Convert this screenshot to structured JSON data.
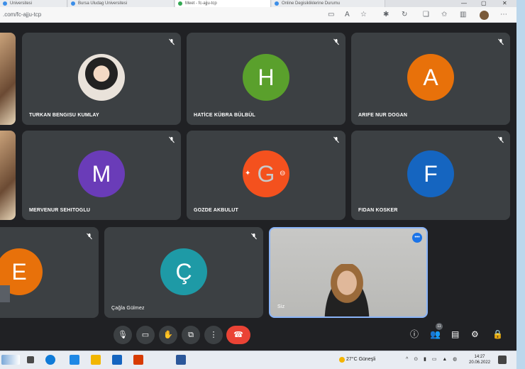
{
  "browser": {
    "tabs": [
      {
        "label": "Universitesi"
      },
      {
        "label": "Bursa Uludag Universitesi"
      },
      {
        "label": "Meet - fc-ajju-tcp",
        "active": true
      },
      {
        "label": "Online Degisikliklerine Durumu"
      }
    ],
    "url": ".com/fc-ajju-tcp",
    "window_controls": [
      "—",
      "▢",
      "✕"
    ]
  },
  "participants": [
    {
      "name": "TURKAN BENGISU KUMLAY",
      "type": "photo"
    },
    {
      "name": "HATİCE KÜBRA BÜLBÜL",
      "initial": "H",
      "color": "#5aa02c"
    },
    {
      "name": "ARIFE NUR DOGAN",
      "initial": "A",
      "color": "#e8710a"
    },
    {
      "name": "MERVENUR SEHITOGLU",
      "initial": "M",
      "color": "#6a3cb8"
    },
    {
      "name": "GOZDE AKBULUT",
      "initial": "G",
      "color": "#f4511e"
    },
    {
      "name": "FIDAN KOSKER",
      "initial": "F",
      "color": "#1565c0"
    },
    {
      "name": "",
      "initial": "E",
      "color": "#e8710a"
    },
    {
      "name": "Çağla Gülmez",
      "initial": "Ç",
      "color": "#1e9aa6"
    },
    {
      "name": "Siz",
      "type": "video"
    }
  ],
  "controls": {
    "participant_count": "11"
  },
  "taskbar": {
    "weather": "27°C  Güneşli",
    "time": "14:27",
    "date": "20.06.2022"
  },
  "colors": {
    "meet_bg": "#202124",
    "tile_bg": "#3c4043",
    "hangup": "#ea4335"
  }
}
